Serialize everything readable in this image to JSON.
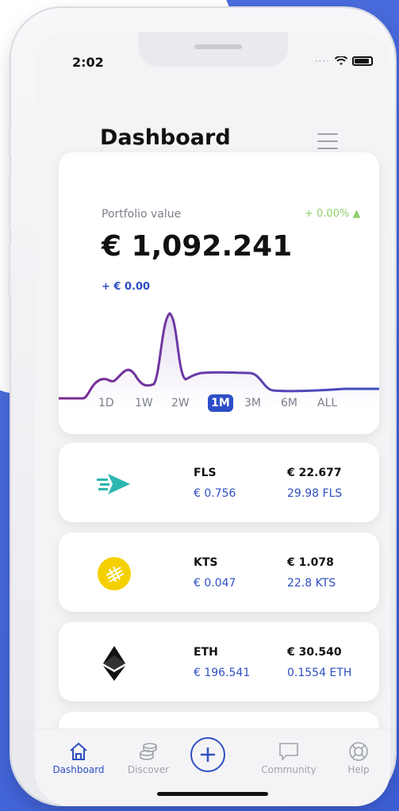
{
  "status": {
    "time": "2:02"
  },
  "header": {
    "title": "Dashboard"
  },
  "portfolio": {
    "label": "Portfolio value",
    "change_pct": "+ 0.00% ▲",
    "value": "€ 1,092.241",
    "delta": "+ € 0.00",
    "ranges": [
      "1D",
      "1W",
      "2W",
      "1M",
      "3M",
      "6M",
      "ALL"
    ],
    "active_range": "1M",
    "line_color": "#5b3fb8"
  },
  "coins": [
    {
      "icon": "fls-arrow-icon",
      "symbol": "FLS",
      "price": "€ 0.756",
      "total": "€ 22.677",
      "amount": "29.98 FLS",
      "color": "#2fb6b0"
    },
    {
      "icon": "kts-coin-icon",
      "symbol": "KTS",
      "price": "€ 0.047",
      "total": "€ 1.078",
      "amount": "22.8 KTS",
      "color": "#f5d000"
    },
    {
      "icon": "ethereum-icon",
      "symbol": "ETH",
      "price": "€ 196.541",
      "total": "€ 30.540",
      "amount": "0.1554 ETH",
      "color": "#111111"
    }
  ],
  "nav": {
    "dashboard": "Dashboard",
    "discover": "Discover",
    "community": "Community",
    "help": "Help"
  },
  "colors": {
    "accent": "#2f4fc1",
    "positive": "#8fd06e"
  }
}
